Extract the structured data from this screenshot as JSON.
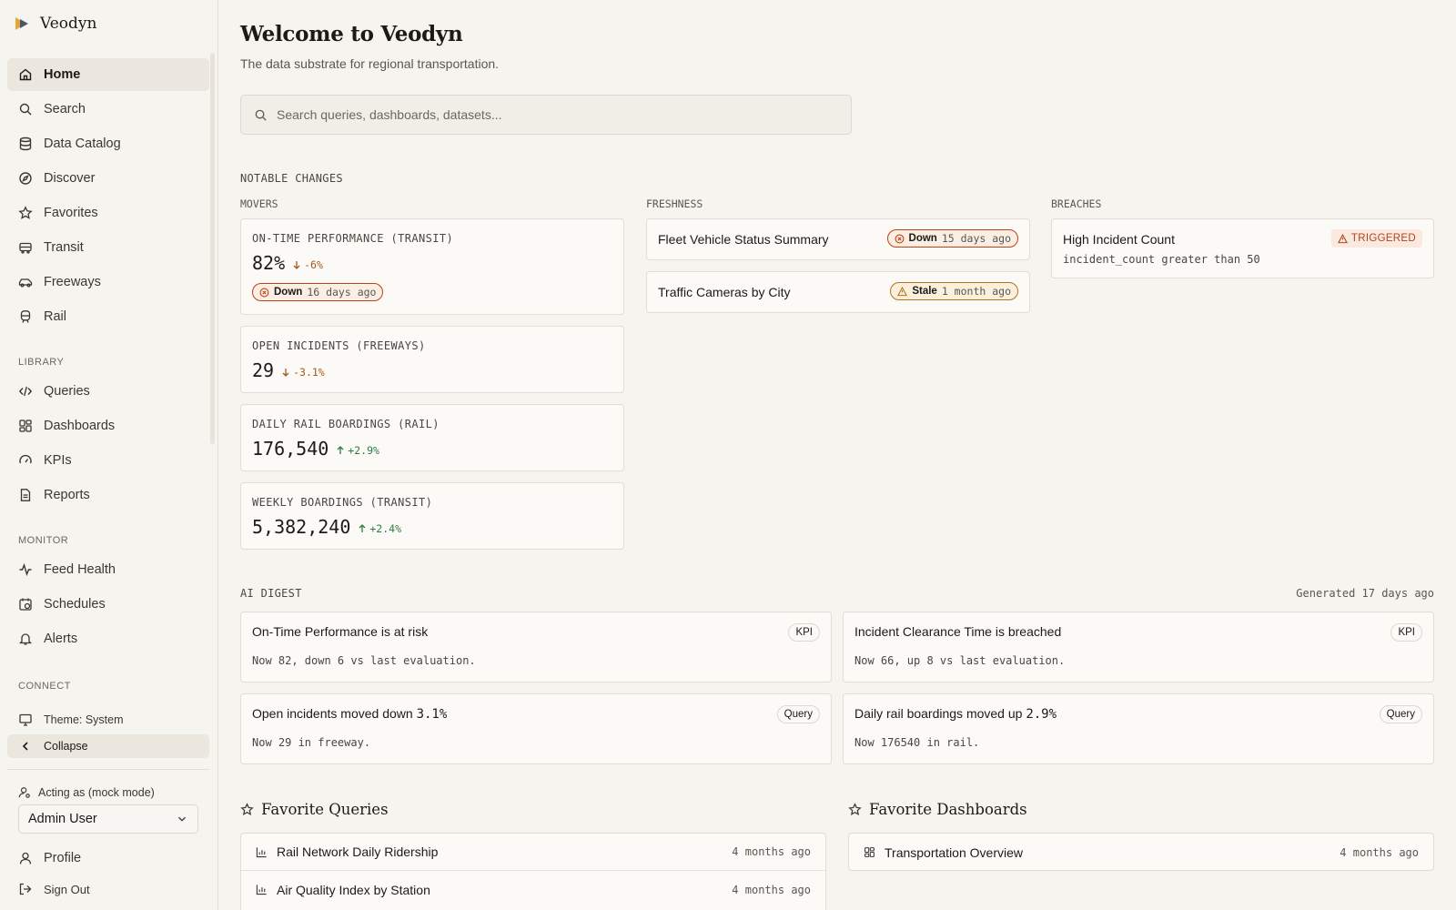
{
  "app": {
    "name": "Veodyn"
  },
  "sidebar": {
    "primary": [
      {
        "label": "Home",
        "icon": "home-icon",
        "active": true
      },
      {
        "label": "Search",
        "icon": "search-icon"
      },
      {
        "label": "Data Catalog",
        "icon": "database-icon"
      },
      {
        "label": "Discover",
        "icon": "compass-icon"
      },
      {
        "label": "Favorites",
        "icon": "star-icon"
      },
      {
        "label": "Transit",
        "icon": "bus-icon"
      },
      {
        "label": "Freeways",
        "icon": "car-icon"
      },
      {
        "label": "Rail",
        "icon": "train-icon"
      }
    ],
    "library_label": "LIBRARY",
    "library": [
      {
        "label": "Queries",
        "icon": "code-icon"
      },
      {
        "label": "Dashboards",
        "icon": "dashboard-icon"
      },
      {
        "label": "KPIs",
        "icon": "gauge-icon"
      },
      {
        "label": "Reports",
        "icon": "file-icon"
      }
    ],
    "monitor_label": "MONITOR",
    "monitor": [
      {
        "label": "Feed Health",
        "icon": "activity-icon"
      },
      {
        "label": "Schedules",
        "icon": "calendar-clock-icon"
      },
      {
        "label": "Alerts",
        "icon": "bell-icon"
      }
    ],
    "connect_label": "CONNECT",
    "theme_label": "Theme: System",
    "collapse_label": "Collapse",
    "acting_label": "Acting as (mock mode)",
    "acting_user": "Admin User",
    "profile_label": "Profile",
    "signout_label": "Sign Out"
  },
  "header": {
    "title": "Welcome to Veodyn",
    "subtitle": "The data substrate for regional transportation.",
    "search_placeholder": "Search queries, dashboards, datasets..."
  },
  "notable": {
    "label": "NOTABLE CHANGES",
    "movers_label": "MOVERS",
    "freshness_label": "FRESHNESS",
    "breaches_label": "BREACHES",
    "movers": [
      {
        "name": "ON-TIME PERFORMANCE (TRANSIT)",
        "value": "82%",
        "delta": "-6%",
        "direction": "down",
        "status": "Down",
        "status_ago": "16 days ago"
      },
      {
        "name": "OPEN INCIDENTS (FREEWAYS)",
        "value": "29",
        "delta": "-3.1%",
        "direction": "down"
      },
      {
        "name": "DAILY RAIL BOARDINGS (RAIL)",
        "value": "176,540",
        "delta": "+2.9%",
        "direction": "up"
      },
      {
        "name": "WEEKLY BOARDINGS (TRANSIT)",
        "value": "5,382,240",
        "delta": "+2.4%",
        "direction": "up"
      }
    ],
    "freshness": [
      {
        "name": "Fleet Vehicle Status Summary",
        "status": "Down",
        "ago": "15 days ago",
        "kind": "down"
      },
      {
        "name": "Traffic Cameras by City",
        "status": "Stale",
        "ago": "1 month ago",
        "kind": "stale"
      }
    ],
    "breaches": [
      {
        "name": "High Incident Count",
        "condition": "incident_count greater than 50",
        "status": "TRIGGERED"
      }
    ]
  },
  "digest": {
    "label": "AI DIGEST",
    "generated": "Generated 17 days ago",
    "items": [
      {
        "title": "On-Time Performance is at risk",
        "desc": "Now 82, down 6 vs last evaluation.",
        "tag": "KPI"
      },
      {
        "title": "Incident Clearance Time is breached",
        "desc": "Now 66, up 8 vs last evaluation.",
        "tag": "KPI"
      },
      {
        "title_prefix": "Open incidents moved down ",
        "title_num": "3.1%",
        "desc": "Now 29 in freeway.",
        "tag": "Query"
      },
      {
        "title_prefix": "Daily rail boardings moved up ",
        "title_num": "2.9%",
        "desc": "Now 176540 in rail.",
        "tag": "Query"
      }
    ]
  },
  "favorites": {
    "queries_title": "Favorite Queries",
    "queries": [
      {
        "name": "Rail Network Daily Ridership",
        "ago": "4 months ago"
      },
      {
        "name": "Air Quality Index by Station",
        "ago": "4 months ago"
      }
    ],
    "dashboards_title": "Favorite Dashboards",
    "dashboards": [
      {
        "name": "Transportation Overview",
        "ago": "4 months ago"
      }
    ]
  }
}
